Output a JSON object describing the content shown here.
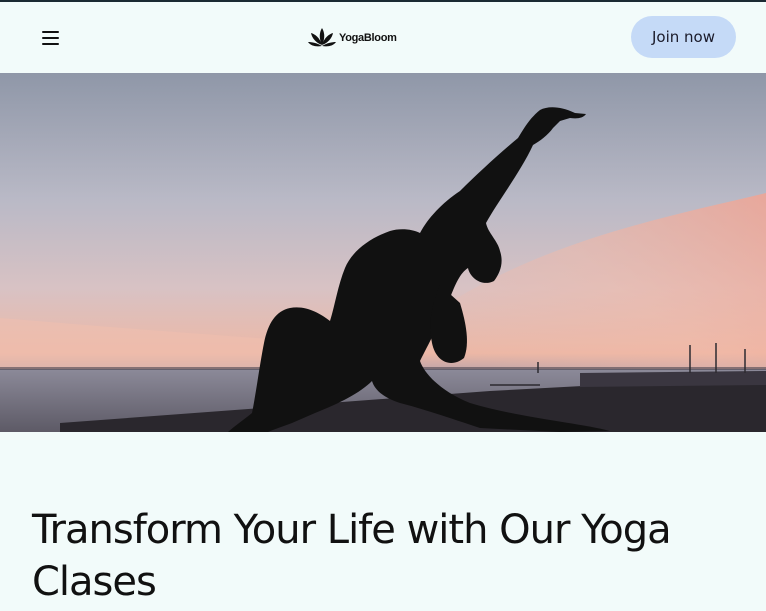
{
  "header": {
    "brand": "YogaBloom",
    "join_label": "Join now",
    "menu_icon": "hamburger-icon",
    "logo_icon": "lotus-icon"
  },
  "hero": {
    "image": "yoga-silhouette-sunset"
  },
  "main": {
    "headline": "Transform Your Life with Our Yoga Clases"
  },
  "colors": {
    "background": "#f2fbfa",
    "join_button": "#c5daf7",
    "text": "#111111"
  }
}
